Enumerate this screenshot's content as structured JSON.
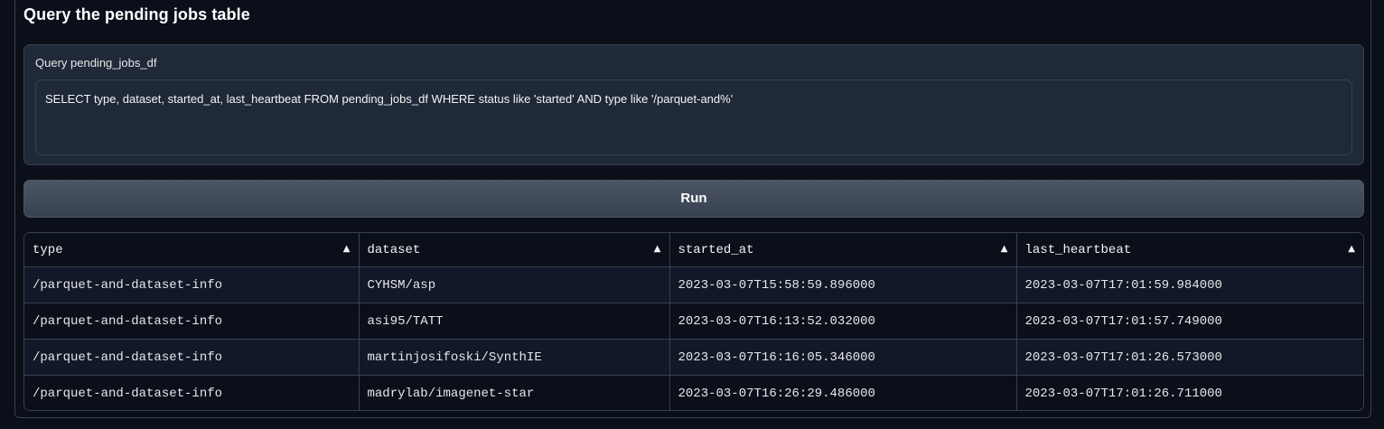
{
  "section": {
    "title": "Query the pending jobs table"
  },
  "query": {
    "label": "Query pending_jobs_df",
    "value": "SELECT type, dataset, started_at, last_heartbeat FROM pending_jobs_df WHERE status like 'started' AND type like '/parquet-and%'"
  },
  "run_button": {
    "label": "Run"
  },
  "table": {
    "columns": [
      {
        "label": "type",
        "sort_icon": "sort-ascending-icon",
        "sort_glyph": "▲"
      },
      {
        "label": "dataset",
        "sort_icon": "sort-ascending-icon",
        "sort_glyph": "▲"
      },
      {
        "label": "started_at",
        "sort_icon": "sort-ascending-icon",
        "sort_glyph": "▲"
      },
      {
        "label": "last_heartbeat",
        "sort_icon": "sort-ascending-icon",
        "sort_glyph": "▲"
      }
    ],
    "rows": [
      [
        "/parquet-and-dataset-info",
        "CYHSM/asp",
        "2023-03-07T15:58:59.896000",
        "2023-03-07T17:01:59.984000"
      ],
      [
        "/parquet-and-dataset-info",
        "asi95/TATT",
        "2023-03-07T16:13:52.032000",
        "2023-03-07T17:01:57.749000"
      ],
      [
        "/parquet-and-dataset-info",
        "martinjosifoski/SynthIE",
        "2023-03-07T16:16:05.346000",
        "2023-03-07T17:01:26.573000"
      ],
      [
        "/parquet-and-dataset-info",
        "madrylab/imagenet-star",
        "2023-03-07T16:26:29.486000",
        "2023-03-07T17:01:26.711000"
      ]
    ]
  },
  "colors": {
    "background": "#0b0f19",
    "panel": "#1f2937",
    "border": "#374151",
    "button": "#4b5563",
    "text": "#f3f4f6"
  }
}
